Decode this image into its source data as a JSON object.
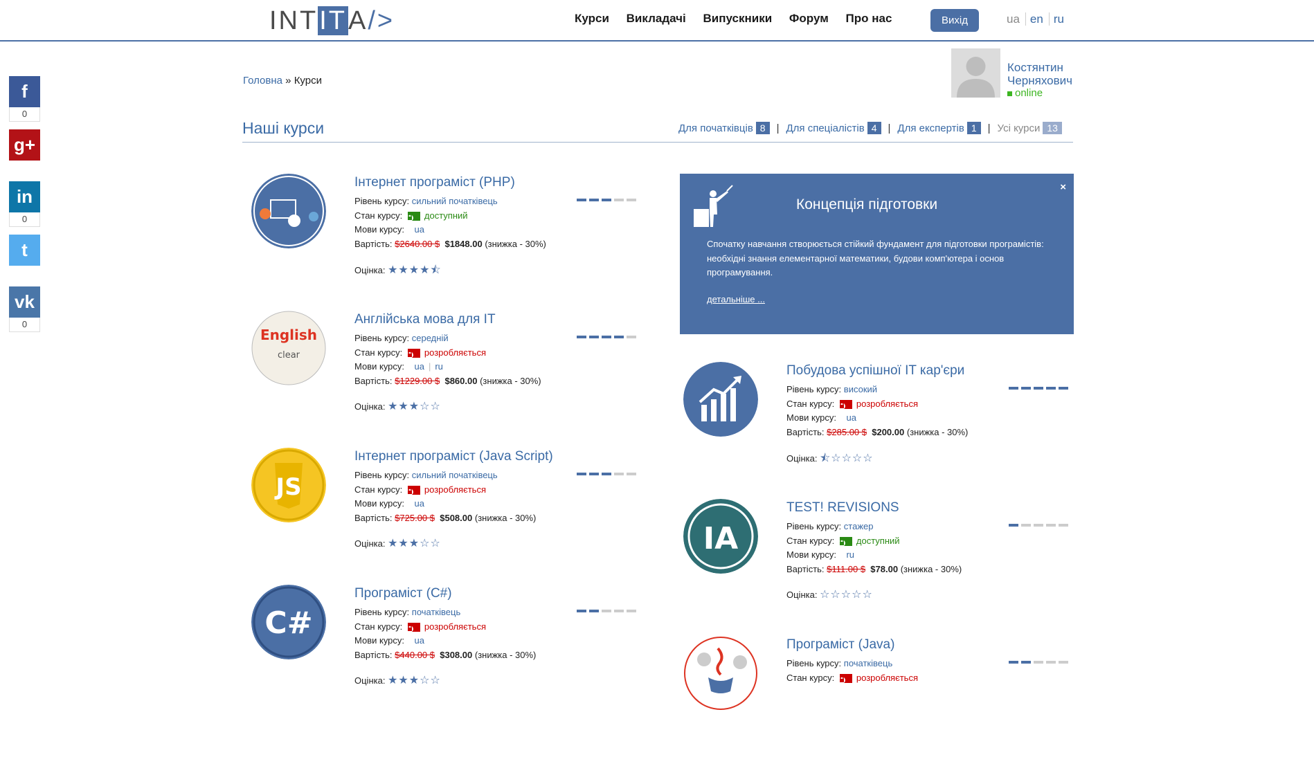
{
  "logo": {
    "part1": "INT",
    "part2": "IT",
    "part3": "A",
    "part4": "/>"
  },
  "nav": [
    "Курси",
    "Викладачі",
    "Випускники",
    "Форум",
    "Про нас"
  ],
  "logout_label": "Вихід",
  "languages": {
    "current": "ua",
    "others": [
      "en",
      "ru"
    ]
  },
  "social": [
    {
      "icon": "facebook-icon",
      "glyph": "f",
      "color": "#3b5998",
      "count": "0"
    },
    {
      "icon": "google-plus-icon",
      "glyph": "g+",
      "color": "#b31217",
      "count": null
    },
    {
      "icon": "linkedin-icon",
      "glyph": "in",
      "color": "#0e76a8",
      "count": "0"
    },
    {
      "icon": "twitter-icon",
      "glyph": "t",
      "color": "#55acee",
      "count": null
    },
    {
      "icon": "vk-icon",
      "glyph": "vk",
      "color": "#4a76a8",
      "count": "0"
    }
  ],
  "breadcrumb": {
    "home": "Головна",
    "sep": "»",
    "current": "Курси"
  },
  "user": {
    "first": "Костянтин",
    "last": "Черняхович",
    "status": "online"
  },
  "section_title": "Наші курси",
  "filters": [
    {
      "label": "Для початківців",
      "count": "8"
    },
    {
      "label": "Для спеціалістів",
      "count": "4"
    },
    {
      "label": "Для експертів",
      "count": "1"
    },
    {
      "label": "Усі курси",
      "count": "13"
    }
  ],
  "labels": {
    "level": "Рівень курсу:",
    "status": "Стан курсу:",
    "langs": "Мови курсу:",
    "price": "Вартість:",
    "rating": "Оцінка:"
  },
  "concept": {
    "title": "Концепція підготовки",
    "text": "Спочатку навчання створюється стійкий фундамент для підготовки програмістів: необхідні знання елементарної математики, будови комп'ютера і основ програмування.",
    "more": "детальніше ...",
    "close": "×"
  },
  "courses_left": [
    {
      "name": "Інтернет програміст (PHP)",
      "level": "сильний початківець",
      "status": "доступний",
      "available": true,
      "langs": [
        "ua"
      ],
      "old_price": "$2640.00 $",
      "price": "$1848.00",
      "discount": "(знижка - 30%)",
      "level_bars": 3,
      "stars": "★★★★⯪"
    },
    {
      "name": "Англійська мова для IT",
      "level": "середній",
      "status": "розробляється",
      "available": false,
      "langs": [
        "ua",
        "ru"
      ],
      "old_price": "$1229.00 $",
      "price": "$860.00",
      "discount": "(знижка - 30%)",
      "level_bars": 4,
      "stars": "★★★☆☆"
    },
    {
      "name": "Інтернет програміст (Java Script)",
      "level": "сильний початківець",
      "status": "розробляється",
      "available": false,
      "langs": [
        "ua"
      ],
      "old_price": "$725.00 $",
      "price": "$508.00",
      "discount": "(знижка - 30%)",
      "level_bars": 3,
      "stars": "★★★☆☆"
    },
    {
      "name": "Програміст (C#)",
      "level": "початківець",
      "status": "розробляється",
      "available": false,
      "langs": [
        "ua"
      ],
      "old_price": "$440.00 $",
      "price": "$308.00",
      "discount": "(знижка - 30%)",
      "level_bars": 2,
      "stars": "★★★☆☆"
    }
  ],
  "courses_right": [
    {
      "name": "Побудова успішної IT кар'єри",
      "level": "високий",
      "status": "розробляється",
      "available": false,
      "langs": [
        "ua"
      ],
      "old_price": "$285.00 $",
      "price": "$200.00",
      "discount": "(знижка - 30%)",
      "level_bars": 5,
      "stars": "⯪☆☆☆☆"
    },
    {
      "name": "TEST! REVISIONS",
      "level": "стажер",
      "status": "доступний",
      "available": true,
      "langs": [
        "ru"
      ],
      "old_price": "$111.00 $",
      "price": "$78.00",
      "discount": "(знижка - 30%)",
      "level_bars": 1,
      "stars": "☆☆☆☆☆"
    },
    {
      "name": "Програміст (Java)",
      "level": "початківець",
      "status": "розробляється",
      "available": false,
      "langs": [],
      "old_price": "",
      "price": "",
      "discount": "",
      "level_bars": 2,
      "stars": ""
    }
  ],
  "icons": {
    "php": "<php>",
    "english": "English",
    "js": "JS",
    "cs": "C#",
    "ita": "IA"
  }
}
